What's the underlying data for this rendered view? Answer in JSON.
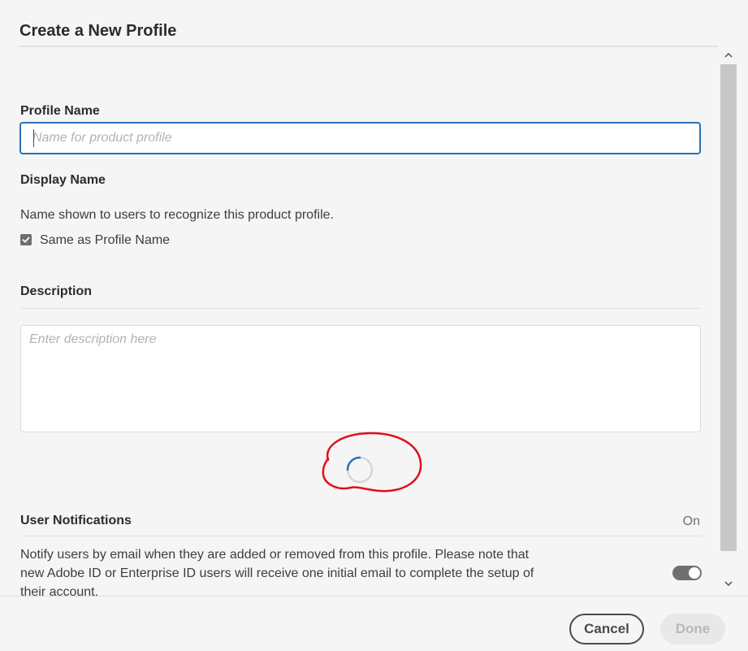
{
  "dialog": {
    "title": "Create a New Profile"
  },
  "profile_name": {
    "label": "Profile Name",
    "placeholder": "Name for product profile",
    "value": ""
  },
  "display_name": {
    "label": "Display Name",
    "helper": "Name shown to users to recognize this product profile.",
    "checkbox_label": "Same as Profile Name",
    "checkbox_checked": true
  },
  "description": {
    "label": "Description",
    "placeholder": "Enter description here",
    "value": ""
  },
  "notifications": {
    "label": "User Notifications",
    "state_label": "On",
    "text": "Notify users by email when they are added or removed from this profile. Please note that new Adobe ID or Enterprise ID users will receive one initial email to complete the setup of their account.",
    "enabled": true
  },
  "footer": {
    "cancel_label": "Cancel",
    "done_label": "Done"
  },
  "colors": {
    "focus_border": "#2b6fba",
    "spinner": "#2b6fba",
    "annotation": "#e0101a",
    "toggle_on": "#707070"
  }
}
